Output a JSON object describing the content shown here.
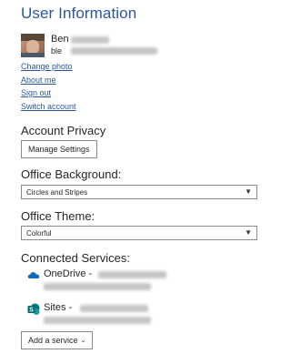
{
  "header": {
    "title": "User Information"
  },
  "user": {
    "name": "Ben",
    "email": "ble"
  },
  "links": {
    "change_photo": "Change photo",
    "about_me": "About me",
    "sign_out": "Sign out",
    "switch_account": "Switch account"
  },
  "privacy": {
    "heading": "Account Privacy",
    "button_label": "Manage Settings"
  },
  "background": {
    "heading": "Office Background:",
    "selected": "Circles and Stripes"
  },
  "theme": {
    "heading": "Office Theme:",
    "selected": "Colorful"
  },
  "services": {
    "heading": "Connected Services:",
    "items": [
      {
        "label": "OneDrive -",
        "icon": "onedrive-icon"
      },
      {
        "label": "Sites -",
        "icon": "sharepoint-icon"
      }
    ],
    "add_button_label": "Add a service"
  },
  "colors": {
    "accent": "#2b579a",
    "onedrive": "#0f6cbd",
    "sharepoint": "#038387"
  }
}
